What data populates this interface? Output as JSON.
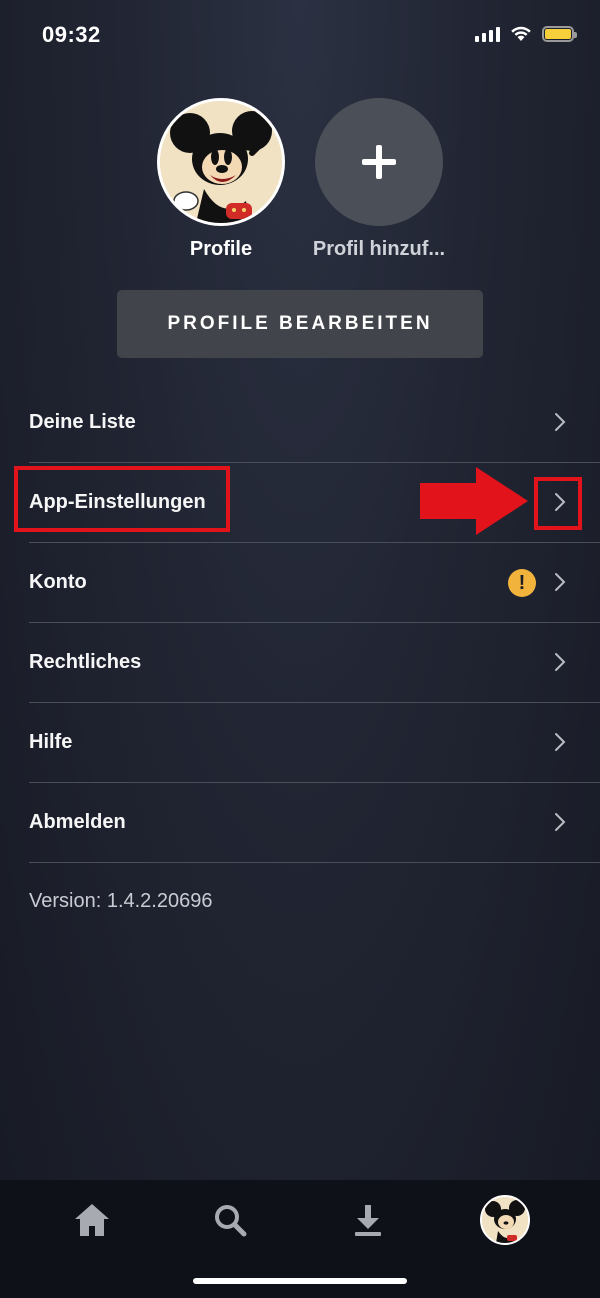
{
  "status_bar": {
    "time": "09:32",
    "battery_color": "#f5d03b"
  },
  "profiles": [
    {
      "name": "Profile",
      "icon": "mickey-avatar"
    },
    {
      "name": "Profil hinzuf...",
      "icon": "plus-icon"
    }
  ],
  "edit_profiles_label": "PROFILE BEARBEITEN",
  "menu": {
    "items": [
      {
        "label": "Deine Liste"
      },
      {
        "label": "App-Einstellungen"
      },
      {
        "label": "Konto",
        "badge": "!"
      },
      {
        "label": "Rechtliches"
      },
      {
        "label": "Hilfe"
      },
      {
        "label": "Abmelden"
      }
    ]
  },
  "version": "Version: 1.4.2.20696",
  "annotation": {
    "color": "#e3131b"
  },
  "tab_bar": {
    "tabs": [
      {
        "icon": "home-icon"
      },
      {
        "icon": "search-icon"
      },
      {
        "icon": "download-icon"
      },
      {
        "icon": "profile-avatar"
      }
    ]
  },
  "colors": {
    "warning": "#f2b33d",
    "button_bg": "#41444b",
    "tab_bar_bg": "#0e1118"
  }
}
